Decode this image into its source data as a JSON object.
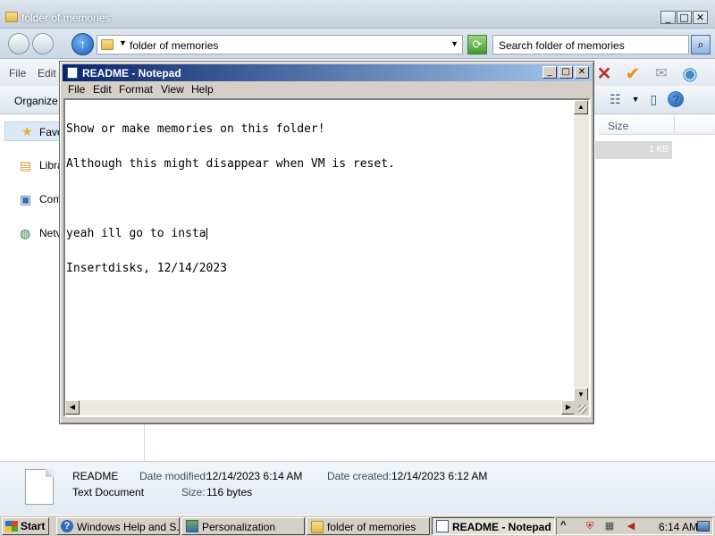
{
  "explorer": {
    "title": "folder of memories",
    "address_path": "folder of memories",
    "search_placeholder": "Search folder of memories",
    "menu": [
      "File",
      "Edit"
    ],
    "organize_label": "Organize",
    "nav": {
      "favorites": "Favo",
      "libraries": "Libra",
      "computer": "Com",
      "network": "Netv"
    },
    "columns": {
      "size": "Size"
    },
    "file_row": {
      "size": "1 KB"
    }
  },
  "details": {
    "name": "README",
    "type": "Text Document",
    "modified_label": "Date modified:",
    "modified_value": "12/14/2023 6:14 AM",
    "created_label": "Date created:",
    "created_value": "12/14/2023 6:12 AM",
    "size_label": "Size:",
    "size_value": "116 bytes"
  },
  "notepad": {
    "title": "README - Notepad",
    "menu": [
      "File",
      "Edit",
      "Format",
      "View",
      "Help"
    ],
    "lines": [
      "Show or make memories on this folder!",
      "Although this might disappear when VM is reset.",
      "",
      "yeah ill go to insta",
      "Insertdisks, 12/14/2023"
    ]
  },
  "taskbar": {
    "start_label": "Start",
    "tasks": [
      {
        "label": "Windows Help and S...",
        "icon": "help-icon",
        "active": false
      },
      {
        "label": "Personalization",
        "icon": "personalization-icon",
        "active": false
      },
      {
        "label": "folder of memories",
        "icon": "folder-icon",
        "active": false
      },
      {
        "label": "README - Notepad",
        "icon": "notepad-icon",
        "active": true
      }
    ],
    "clock": "6:14 AM"
  },
  "colors": {
    "notepad_title_start": "#0a246a",
    "notepad_title_end": "#a6caf0",
    "classic_face": "#d4d0c8",
    "favorites_highlight": "#dbe8f6"
  }
}
